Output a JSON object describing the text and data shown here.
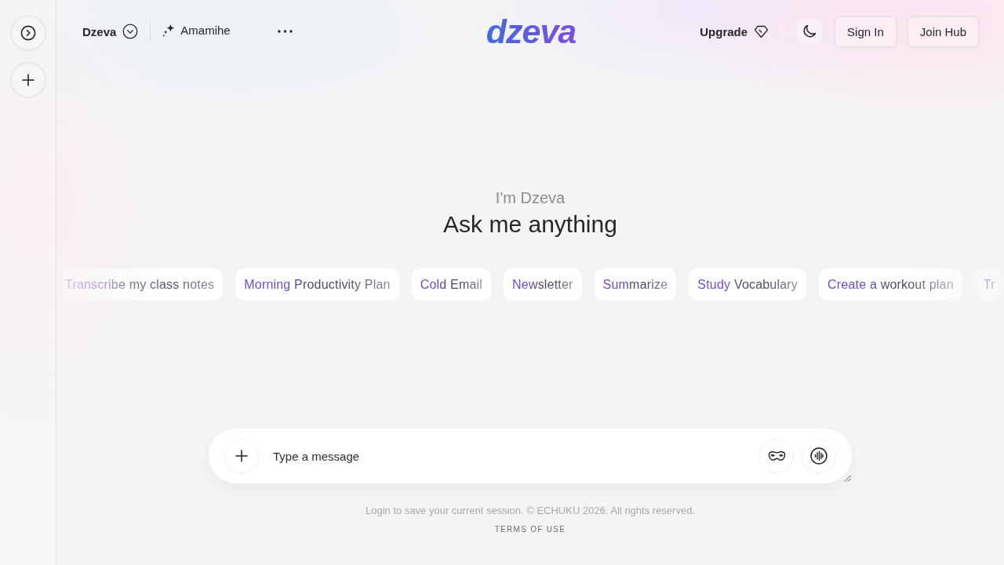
{
  "header": {
    "model_menu": {
      "label": "Dzeva"
    },
    "assistant": {
      "label": "Amamihe"
    },
    "logo": "dzeva",
    "upgrade": {
      "label": "Upgrade"
    },
    "auth_buttons": [
      "Sign In",
      "Join Hub"
    ]
  },
  "hero": {
    "subtitle": "I'm Dzeva",
    "title": "Ask me anything"
  },
  "suggestions": [
    "Transcribe my class notes",
    "Morning Productivity Plan",
    "Cold Email",
    "Newsletter",
    "Summarize",
    "Study Vocabulary",
    "Create a workout plan",
    "Tr"
  ],
  "composer": {
    "placeholder": "Type a message"
  },
  "footer": {
    "notice": "Login to save your current session. © ECHUKU 2026. All rights reserved.",
    "link": "TERMS OF USE"
  }
}
